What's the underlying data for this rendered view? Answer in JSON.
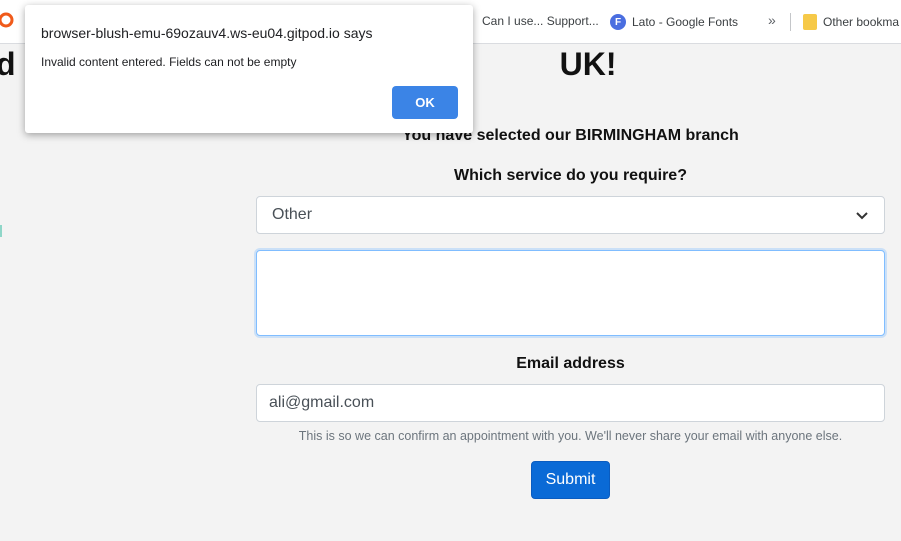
{
  "bookmarks": {
    "items": [
      {
        "label": "Can I use... Support..."
      },
      {
        "label": "Lato - Google Fonts",
        "icon": "F"
      },
      {
        "label": "Other bookma"
      }
    ],
    "more": "»"
  },
  "page": {
    "title": "d u                                                          UK!",
    "branch_text": "You have selected our BIRMINGHAM branch",
    "service_label": "Which service do you require?",
    "service_value": "Other",
    "details_value": "",
    "email_label": "Email address",
    "email_value": "ali@gmail.com",
    "email_help": "This is so we can confirm an appointment with you. We'll never share your email with anyone else.",
    "submit_label": "Submit"
  },
  "dialog": {
    "title": "browser-blush-emu-69ozauv4.ws-eu04.gitpod.io says",
    "message": "Invalid content entered. Fields can not be empty",
    "ok_label": "OK"
  },
  "colors": {
    "accent": "#0a6ad6",
    "dialog_button": "#3b84e6",
    "focus_border": "#80bdff"
  }
}
